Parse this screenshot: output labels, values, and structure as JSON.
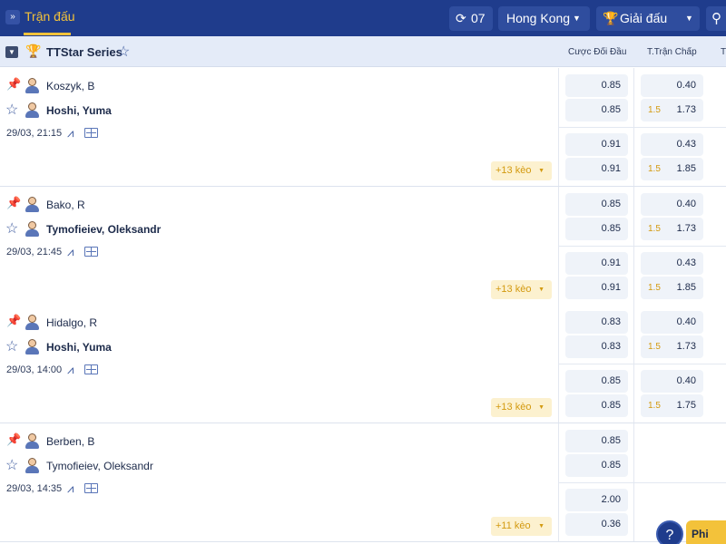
{
  "topbar": {
    "collapse_icon": "double-chevron-down-icon",
    "title": "Trận đấu",
    "refresh_icon": "refresh-icon",
    "refresh_count": "07",
    "region": "Hong Kong",
    "league_icon": "trophy-icon",
    "league_label": "Giải đấu",
    "search_icon": "search-icon"
  },
  "league": {
    "name": "TTStar Series",
    "col_head_1": "Cược Đối Đầu",
    "col_head_2": "T.Trận Chấp",
    "col_head_3": "T"
  },
  "matches": [
    {
      "player1": "Koszyk, B",
      "player2": "Hoshi, Yuma",
      "player2_bold": true,
      "time": "29/03, 21:15",
      "more": "+13 kèo",
      "odds_c1": [
        "0.85",
        "0.85",
        "0.91",
        "0.91"
      ],
      "odds_c2": [
        "0.40",
        "1.73",
        "0.43",
        "1.85"
      ],
      "hc": [
        "",
        "1.5",
        "",
        "1.5"
      ]
    },
    {
      "player1": "Bako, R",
      "player2": "Tymofieiev, Oleksandr",
      "player2_bold": true,
      "time": "29/03, 21:45",
      "more": "+13 kèo",
      "odds_c1": [
        "0.85",
        "0.85",
        "0.91",
        "0.91"
      ],
      "odds_c2": [
        "0.40",
        "1.73",
        "0.43",
        "1.85"
      ],
      "hc": [
        "",
        "1.5",
        "",
        "1.5"
      ]
    },
    {
      "player1": "Hidalgo, R",
      "player2": "Hoshi, Yuma",
      "player2_bold": true,
      "time": "29/03, 14:00",
      "more": "+13 kèo",
      "odds_c1": [
        "0.83",
        "0.83",
        "0.85",
        "0.85"
      ],
      "odds_c2": [
        "0.40",
        "1.73",
        "0.40",
        "1.75"
      ],
      "hc": [
        "",
        "1.5",
        "",
        "1.5"
      ]
    },
    {
      "player1": "Berben, B",
      "player2": "Tymofieiev, Oleksandr",
      "player2_bold": false,
      "time": "29/03, 14:35",
      "more": "+11 kèo",
      "odds_c1": [
        "0.85",
        "0.85",
        "2.00",
        "0.36"
      ],
      "odds_c2": [],
      "hc": []
    }
  ],
  "floating": {
    "help": "?",
    "phi": "Phi"
  }
}
